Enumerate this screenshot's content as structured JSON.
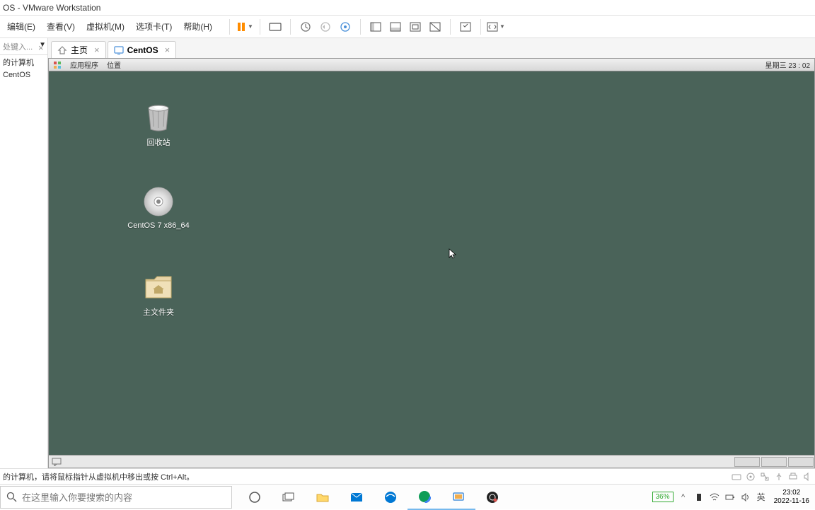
{
  "titlebar": {
    "title": "OS - VMware Workstation"
  },
  "menubar": {
    "items": [
      "编辑(E)",
      "查看(V)",
      "虚拟机(M)",
      "选项卡(T)",
      "帮助(H)"
    ]
  },
  "sidebar": {
    "search_placeholder": "处键入...",
    "items": [
      "的计算机",
      "CentOS"
    ]
  },
  "tabs": {
    "home": "主页",
    "vm": "CentOS"
  },
  "vm_topbar": {
    "apps": "应用程序",
    "places": "位置",
    "clock": "星期三 23 : 02"
  },
  "desktop_icons": {
    "trash": "回收站",
    "disc": "CentOS 7 x86_64",
    "home": "主文件夹"
  },
  "statusbar": {
    "text": "的计算机，请将鼠标指针从虚拟机中移出或按 Ctrl+Alt。"
  },
  "taskbar": {
    "search_placeholder": "在这里输入你要搜索的内容",
    "battery": "36%",
    "ime": "英",
    "time": "23:02",
    "date": "2022-11-16"
  }
}
